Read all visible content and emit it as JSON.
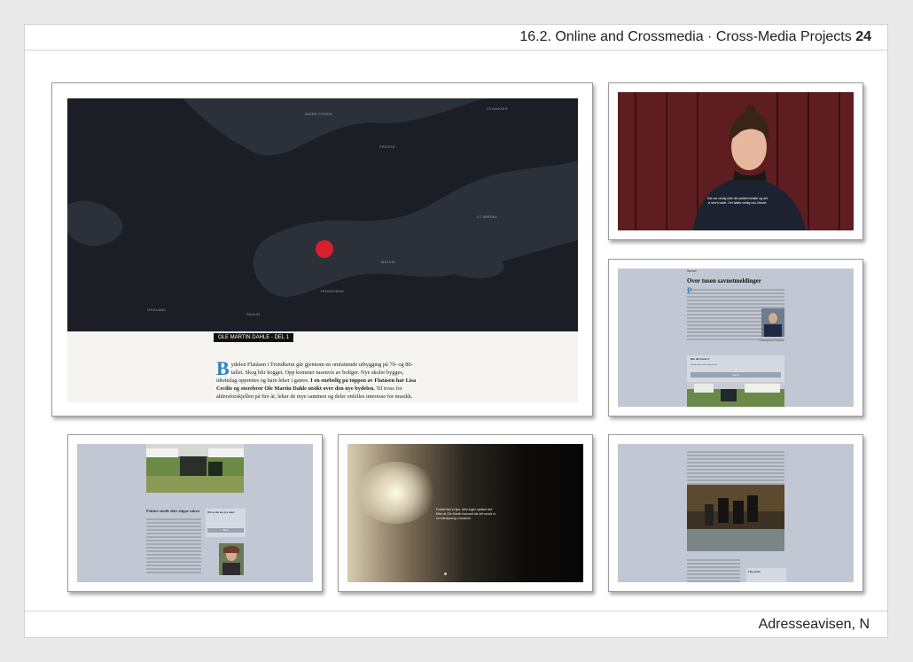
{
  "header": {
    "section": "16.2. Online and Crossmedia · Cross-Media Projects",
    "page": "24"
  },
  "footer": {
    "source": "Adresseavisen, N"
  },
  "map_card": {
    "places": [
      "INDRE FOSEN",
      "LEVANGER",
      "FROSTA",
      "STJØRDAL",
      "MALVIK",
      "TRONDHEIM",
      "ORKLAND",
      "SKAUN"
    ],
    "tag": "OLE MARTIN DAHLE - DEL 1",
    "dropcap": "B",
    "lead": "ydelen Flatåsen i Trondheim går gjennom en omfattende utbygging på 70- og 80-tallet. Skog blir hogget. Opp kommer tusenvis av boliger. Nye skoler bygges, idrettslag opprettes og barn leker i gatere.",
    "bold": " I en enebolig på toppen av Flatåsen har Lisa Cecilie og storebror Ole Martin Dahle utsikt over den nye bydelen.",
    "tail": " Til tross for aldersforskjellen på fire år, leker de mye sammen og deler enfelles interesse for musikk."
  },
  "portrait_card": {
    "subtitle": "Det var veldig ulikt det politiet fortalte og det vi selv trodde. Det føltes veldig rart, likevel.",
    "colors": {
      "wall": "#5a1b1f",
      "coat": "#1d2230"
    }
  },
  "article_card": {
    "kicker": "Savnet",
    "title": "Over tusen savnetmeldinger",
    "dropcap": "P",
    "photo_caption": "Politiinspektør i Trøndelag",
    "box_title": "Ble du berørt?",
    "box_text": "Har du tips, send e-post til oss",
    "box_button": "Send"
  },
  "search_card": {
    "title": "Politiet skulle ikke slippe saken",
    "box_title": "Bli varslet om nye saker",
    "box_button": "Send"
  },
  "water_card": {
    "subtitle": "Politiet fikk et tips. Men ingen sjekket det. Etter at Ole Martin forsvant ble det sendt ut en etterlysning i mediene."
  },
  "rescue_card": {
    "box_title": "Følg saken"
  },
  "colors": {
    "accent": "#2f7fc1",
    "marker": "#d6202f",
    "panel": "#c2c8d3",
    "map_bg": "#232730"
  }
}
